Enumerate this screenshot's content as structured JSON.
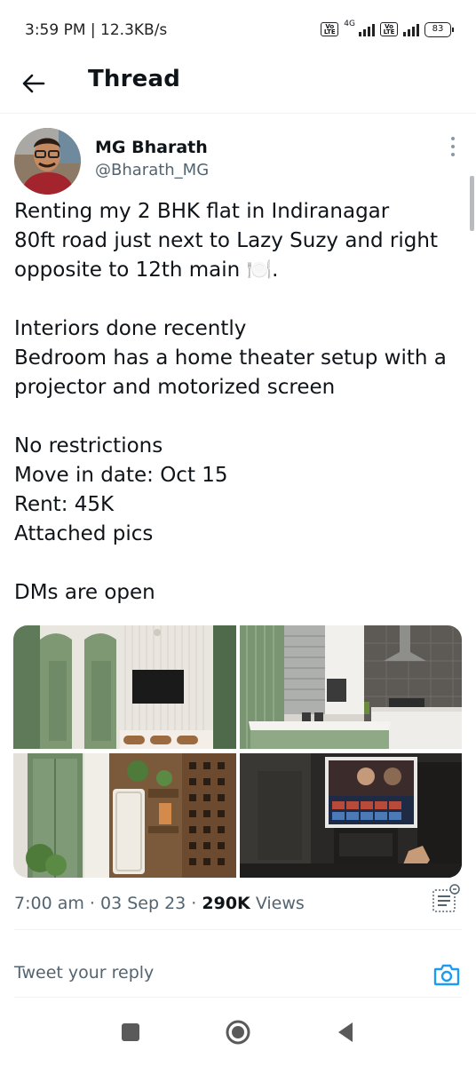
{
  "status_bar": {
    "time_text": "3:59 PM | 12.3KB/s",
    "volte_1": "Vo LTE",
    "network": "4G",
    "volte_2": "Vo LTE",
    "battery": "83"
  },
  "header": {
    "title": "Thread",
    "back_icon": "arrow-left-icon"
  },
  "tweet": {
    "author_name": "MG Bharath",
    "author_handle": "@Bharath_MG",
    "lines": [
      "Renting my 2 BHK flat in Indiranagar",
      "80ft road just next to Lazy Suzy and right",
      "opposite to 12th main 🍽️.",
      "",
      "Interiors done recently",
      "Bedroom has a home theater setup with a",
      "projector and motorized screen",
      "",
      "No restrictions",
      "Move in date: Oct 15",
      "Rent: 45K",
      "Attached pics",
      "",
      "DMs are open"
    ],
    "media": [
      {
        "icon": "photo-living-room"
      },
      {
        "icon": "photo-kitchen"
      },
      {
        "icon": "photo-cabinet"
      },
      {
        "icon": "photo-home-theater"
      }
    ],
    "time": "7:00 am",
    "separator": "·",
    "date": "03 Sep 23",
    "views_count": "290K",
    "views_label": "Views"
  },
  "reply": {
    "placeholder": "Tweet your reply",
    "camera_icon": "camera-icon"
  },
  "nav": {
    "recents_icon": "square-icon",
    "home_icon": "circle-icon",
    "back_icon": "triangle-back-icon"
  },
  "colors": {
    "text_primary": "#0f1419",
    "text_secondary": "#536471",
    "accent": "#1d9bf0",
    "divider": "#eff3f4"
  }
}
